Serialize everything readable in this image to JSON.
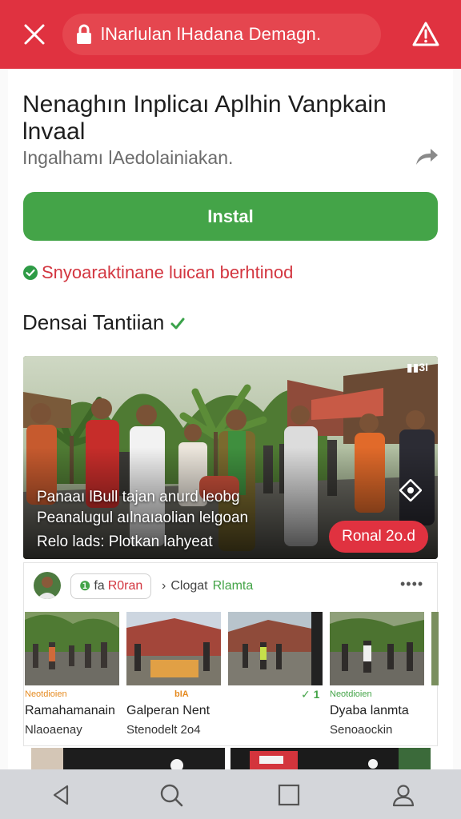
{
  "browser": {
    "url_text": "lNarlulan lHadana Demagn.",
    "icons": {
      "close": "close-icon",
      "lock": "lock-icon",
      "warning": "warning-icon"
    }
  },
  "app": {
    "title": "Nenaghın Inplicaı Aplhin Vanpkain lnvaal",
    "subtitle": "Ingalhamı lAedolainiakan.",
    "install_label": "Instal",
    "verify_text": "Snyoaraktinane luican berhtinod",
    "section_title": "Densai Tantiian"
  },
  "hero": {
    "caption_line1": "Panaaı lBull tajan anurd leobg",
    "caption_line2": "Peanalugul aılnaıaolian lelgoan",
    "caption_line3": "Relo lads: Plotkan lahyeat",
    "badge": "Ronal 2o.d",
    "corner_text": "▮▮3I"
  },
  "feed": {
    "tag_glyph": "❶",
    "tag_label_a": "fa",
    "tag_label_b": "R0ran",
    "crumb_arrow": "›",
    "crumb_a": "Clogat",
    "crumb_b": "Rlamta",
    "more": "••••",
    "items": [
      {
        "label": "Neotdioien",
        "title": "Ramahamanain",
        "sub": "Nlaoaenay"
      },
      {
        "label": "bIA",
        "title": "Galperan Nent",
        "sub": "Stenodelt 2o4"
      },
      {
        "label": "✓ 1",
        "title": "",
        "sub": ""
      },
      {
        "label": "Neotdioien",
        "title": "Dyaba lanmta",
        "sub": "Senoaockin"
      }
    ]
  },
  "colors": {
    "brand_red": "#e03240",
    "install_green": "#44a448",
    "nav_gray": "#d4d6da"
  },
  "nav": {
    "icons": [
      "back-icon",
      "search-icon",
      "recents-icon",
      "profile-icon"
    ]
  }
}
